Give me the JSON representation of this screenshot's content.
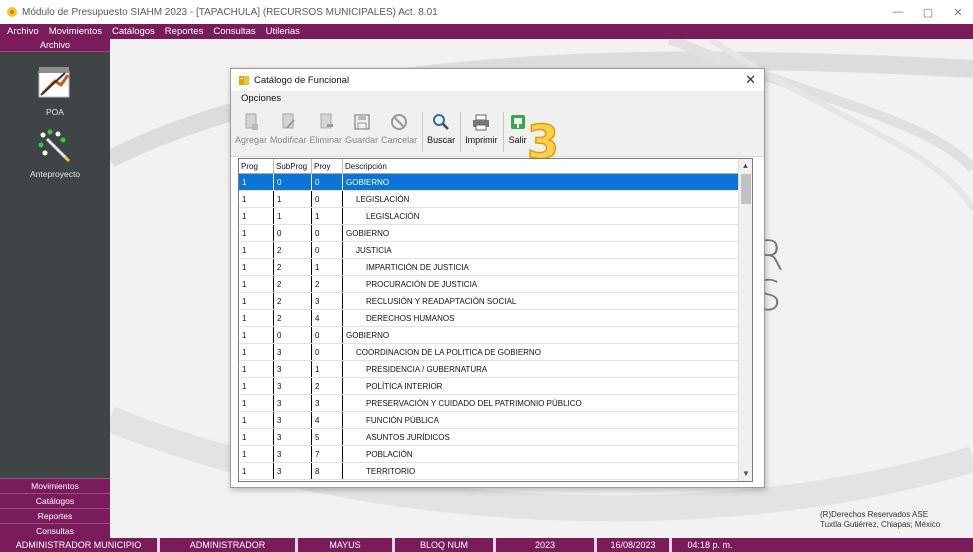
{
  "window": {
    "title": "Módulo de Presupuesto SIAHM 2023 - [TAPACHULA]   (RECURSOS MUNICIPALES)  Act. 8.01",
    "minimize": "—",
    "maximize": "▢",
    "close": "✕"
  },
  "menubar": [
    "Archivo",
    "Movimientos",
    "Catálogos",
    "Reportes",
    "Consultas",
    "Utilerias"
  ],
  "leftpanel": {
    "header": "Archivo",
    "tools": [
      {
        "label": "POA",
        "icon": "poa-icon"
      },
      {
        "label": "Anteproyecto",
        "icon": "anteproyecto-icon"
      }
    ],
    "bottom_tabs": [
      "Movimientos",
      "Catálogos",
      "Reportes",
      "Consultas"
    ]
  },
  "desktop": {
    "letters": [
      "R",
      "S"
    ],
    "copyright_line1": "(R)Derechos Reservados ASE",
    "copyright_line2": "Tuxtla Gutiérrez, Chiapas; México"
  },
  "dialog": {
    "title": "Catálogo de Funcional",
    "close": "✕",
    "menu": "Opciones",
    "toolbar": {
      "agregar": "Agregar",
      "modificar": "Modificar",
      "eliminar": "Eliminar",
      "guardar": "Guardar",
      "cancelar": "Cancelar",
      "buscar": "Buscar",
      "imprimir": "Imprimir",
      "salir": "Salir"
    },
    "annotation_number": "3",
    "grid": {
      "columns": [
        "Prog",
        "SubProg",
        "Proy",
        "Descripción"
      ],
      "rows": [
        {
          "prog": "1",
          "subprog": "0",
          "proy": "0",
          "desc": "GOBIERNO",
          "indent": 0
        },
        {
          "prog": "1",
          "subprog": "1",
          "proy": "0",
          "desc": "LEGISLACIÓN",
          "indent": 1
        },
        {
          "prog": "1",
          "subprog": "1",
          "proy": "1",
          "desc": "LEGISLACIÓN",
          "indent": 2
        },
        {
          "prog": "1",
          "subprog": "0",
          "proy": "0",
          "desc": "GOBIERNO",
          "indent": 0
        },
        {
          "prog": "1",
          "subprog": "2",
          "proy": "0",
          "desc": "JUSTICIA",
          "indent": 1
        },
        {
          "prog": "1",
          "subprog": "2",
          "proy": "1",
          "desc": "IMPARTICIÓN DE JUSTICIA",
          "indent": 2
        },
        {
          "prog": "1",
          "subprog": "2",
          "proy": "2",
          "desc": "PROCURACIÓN DE JUSTICIA",
          "indent": 2
        },
        {
          "prog": "1",
          "subprog": "2",
          "proy": "3",
          "desc": "RECLUSIÓN Y READAPTACIÓN SOCIAL",
          "indent": 2
        },
        {
          "prog": "1",
          "subprog": "2",
          "proy": "4",
          "desc": "DERECHOS HUMANOS",
          "indent": 2
        },
        {
          "prog": "1",
          "subprog": "0",
          "proy": "0",
          "desc": "GOBIERNO",
          "indent": 0
        },
        {
          "prog": "1",
          "subprog": "3",
          "proy": "0",
          "desc": "COORDINACION DE LA POLITICA DE GOBIERNO",
          "indent": 1
        },
        {
          "prog": "1",
          "subprog": "3",
          "proy": "1",
          "desc": "PRESIDENCIA / GUBERNATURA",
          "indent": 2
        },
        {
          "prog": "1",
          "subprog": "3",
          "proy": "2",
          "desc": "POLÍTICA INTERIOR",
          "indent": 2
        },
        {
          "prog": "1",
          "subprog": "3",
          "proy": "3",
          "desc": "PRESERVACIÓN Y CUIDADO DEL PATRIMONIO PÚBLICO",
          "indent": 2
        },
        {
          "prog": "1",
          "subprog": "3",
          "proy": "4",
          "desc": "FUNCIÓN PÚBLICA",
          "indent": 2
        },
        {
          "prog": "1",
          "subprog": "3",
          "proy": "5",
          "desc": "ASUNTOS JURÍDICOS",
          "indent": 2
        },
        {
          "prog": "1",
          "subprog": "3",
          "proy": "7",
          "desc": "POBLACIÓN",
          "indent": 2
        },
        {
          "prog": "1",
          "subprog": "3",
          "proy": "8",
          "desc": "TERRITORIO",
          "indent": 2
        }
      ],
      "selected_row": 0
    }
  },
  "statusbar": [
    "ADMINISTRADOR MUNICIPIO",
    "ADMINISTRADOR",
    "MAYUS",
    "BLOQ NUM",
    "2023",
    "16/08/2023",
    "04:18 p. m."
  ],
  "colors": {
    "accent": "#7a1b5c",
    "panel": "#3f4547",
    "selection": "#0a74d9"
  }
}
